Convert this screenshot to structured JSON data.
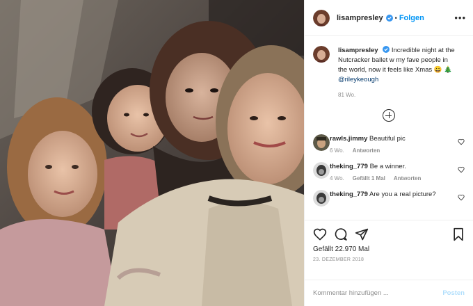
{
  "header": {
    "username": "lisampresley",
    "separator": "•",
    "follow_label": "Folgen",
    "more_icon": "ellipsis-icon"
  },
  "caption": {
    "username": "lisampresley",
    "text": "Incredible night at the Nutcracker ballet w my fave people in the world, now it feels like Xmas 😀 🎄 ",
    "mention": "@rileykeough",
    "time": "81 Wo."
  },
  "load_more_icon": "plus-circle-icon",
  "comments": [
    {
      "username": "rawls.jimmy",
      "text": "Beautiful pic",
      "time": "6 Wo.",
      "likes": "",
      "reply": "Antworten"
    },
    {
      "username": "theking_779",
      "text": "Be a winner.",
      "time": "4 Wo.",
      "likes": "Gefällt 1 Mal",
      "reply": "Antworten"
    },
    {
      "username": "theking_779",
      "text": "Are you a real picture?",
      "time": "",
      "likes": "",
      "reply": ""
    }
  ],
  "actions": {
    "likes_text": "Gefällt 22.970 Mal",
    "date": "23. DEZEMBER 2018"
  },
  "add_comment": {
    "placeholder": "Kommentar hinzufügen ...",
    "post_label": "Posten"
  },
  "colors": {
    "accent": "#0095f6",
    "post_disabled": "#b2dffc",
    "muted": "#8e8e8e",
    "text": "#262626"
  }
}
